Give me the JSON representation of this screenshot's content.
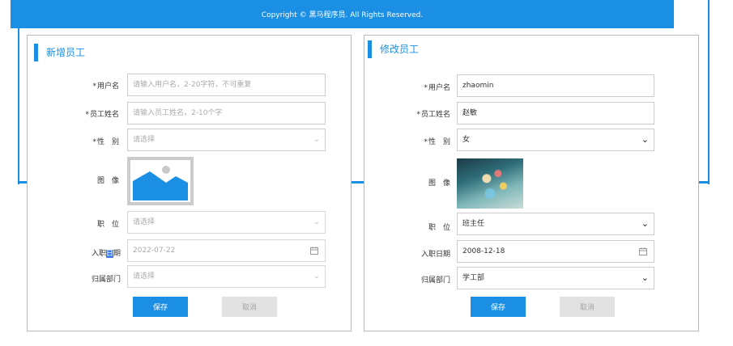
{
  "background": {
    "copyright": "Copyright © 黑马程序员. All Rights Reserved."
  },
  "add_dialog": {
    "title": "新增员工",
    "username_label": "用户名",
    "username_placeholder": "请输入用户名，2-20字符，不可重复",
    "name_label": "员工姓名",
    "name_placeholder": "请输入员工姓名，2-10个字",
    "gender_label": "性　别",
    "gender_placeholder": "请选择",
    "image_label": "图　像",
    "position_label": "职　位",
    "position_placeholder": "请选择",
    "entry_label_pre": "入职",
    "entry_label_hl": "日",
    "entry_label_post": "期",
    "entry_placeholder": "2022-07-22",
    "dept_label": "归属部门",
    "dept_placeholder": "请选择",
    "save": "保存",
    "cancel": "取消"
  },
  "edit_dialog": {
    "title": "修改员工",
    "username_label": "用户名",
    "username_value": "zhaomin",
    "name_label": "员工姓名",
    "name_value": "赵敏",
    "gender_label": "性　别",
    "gender_value": "女",
    "image_label": "图　像",
    "position_label": "职　位",
    "position_value": "班主任",
    "entry_label": "入职日期",
    "entry_value": "2008-12-18",
    "dept_label": "归属部门",
    "dept_value": "学工部",
    "save": "保存",
    "cancel": "取消"
  },
  "colors": {
    "accent": "#1a8fe3",
    "disabled": "#e2e2e2"
  }
}
